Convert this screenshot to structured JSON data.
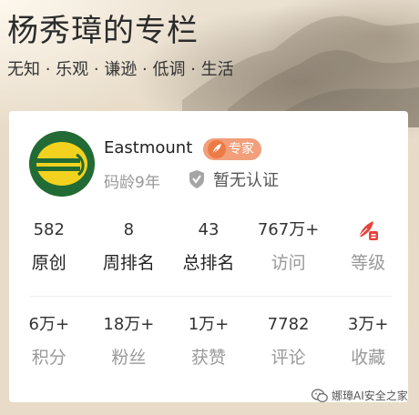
{
  "header": {
    "title": "杨秀璋的专栏",
    "motto": "无知 · 乐观 · 谦逊 · 低调 · 生活"
  },
  "profile": {
    "username": "Eastmount",
    "badge_label": "专家",
    "code_age": "码龄9年",
    "verify_text": "暂无认证",
    "avatar_icon": "avatar-logo",
    "badge_color": "#f29f7b"
  },
  "stats_top": [
    {
      "value": "582",
      "label": "原创"
    },
    {
      "value": "8",
      "label": "周排名"
    },
    {
      "value": "43",
      "label": "总排名"
    },
    {
      "value": "767万+",
      "label": "访问"
    },
    {
      "value": "",
      "label": "等级",
      "icon": "level-icon"
    }
  ],
  "stats_bottom": [
    {
      "value": "6万+",
      "label": "积分"
    },
    {
      "value": "18万+",
      "label": "粉丝"
    },
    {
      "value": "1万+",
      "label": "获赞"
    },
    {
      "value": "7782",
      "label": "评论"
    },
    {
      "value": "3万+",
      "label": "收藏"
    }
  ],
  "watermark": {
    "text": "娜璋AI安全之家",
    "icon": "wechat-icon"
  }
}
